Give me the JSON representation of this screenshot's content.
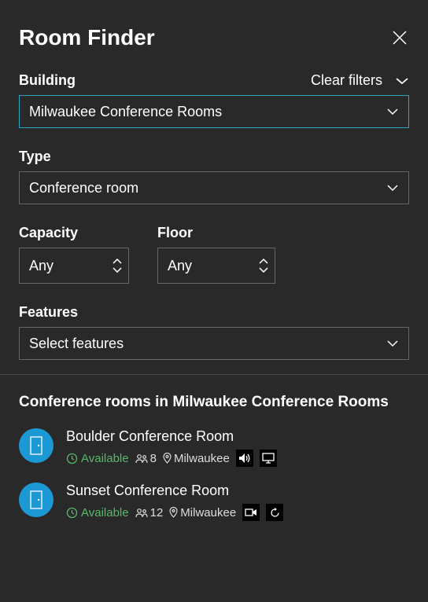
{
  "header": {
    "title": "Room Finder"
  },
  "filters": {
    "building": {
      "label": "Building",
      "value": "Milwaukee Conference Rooms",
      "clear_label": "Clear filters"
    },
    "type": {
      "label": "Type",
      "value": "Conference room"
    },
    "capacity": {
      "label": "Capacity",
      "value": "Any"
    },
    "floor": {
      "label": "Floor",
      "value": "Any"
    },
    "features": {
      "label": "Features",
      "value": "Select features"
    }
  },
  "results": {
    "heading": "Conference rooms in Milwaukee Conference Rooms",
    "rooms": [
      {
        "name": "Boulder Conference Room",
        "status": "Available",
        "capacity": "8",
        "location": "Milwaukee",
        "features": [
          "audio",
          "display"
        ]
      },
      {
        "name": "Sunset Conference Room",
        "status": "Available",
        "capacity": "12",
        "location": "Milwaukee",
        "features": [
          "video",
          "refresh"
        ]
      }
    ]
  }
}
